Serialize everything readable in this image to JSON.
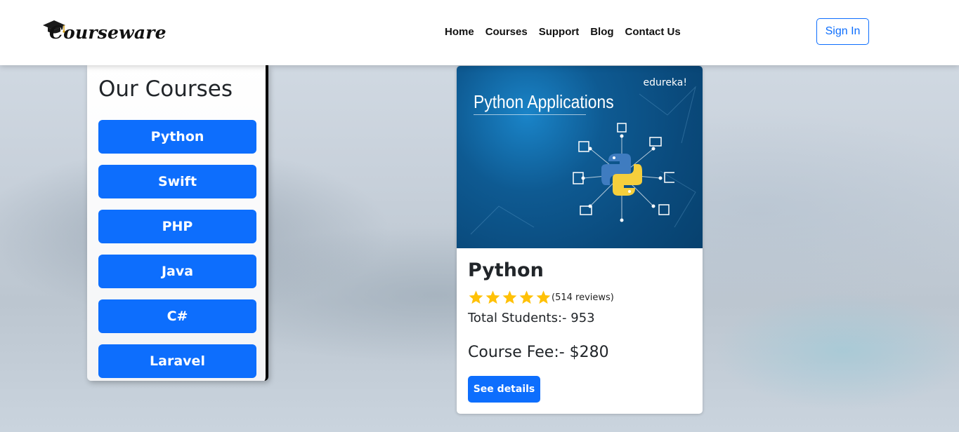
{
  "header": {
    "logo_text": "Courseware",
    "logo_icon": "graduation-cap-icon",
    "nav": [
      "Home",
      "Courses",
      "Support",
      "Blog",
      "Contact Us"
    ],
    "signin_label": "Sign In"
  },
  "sidebar": {
    "title": "Our Courses",
    "courses": [
      "Python",
      "Swift",
      "PHP",
      "Java",
      "C#",
      "Laravel"
    ]
  },
  "course_card": {
    "image": {
      "title": "Python Applications",
      "brand": "edureka!",
      "icon": "python-logo-icon"
    },
    "title": "Python",
    "rating": 5,
    "reviews": "(514 reviews)",
    "students": "Total Students:- 953",
    "fee": "Course Fee:- $280",
    "details_label": "See details"
  },
  "colors": {
    "primary": "#0d6efd",
    "star": "#ffc107",
    "image_bg": "#0a4a7c"
  }
}
